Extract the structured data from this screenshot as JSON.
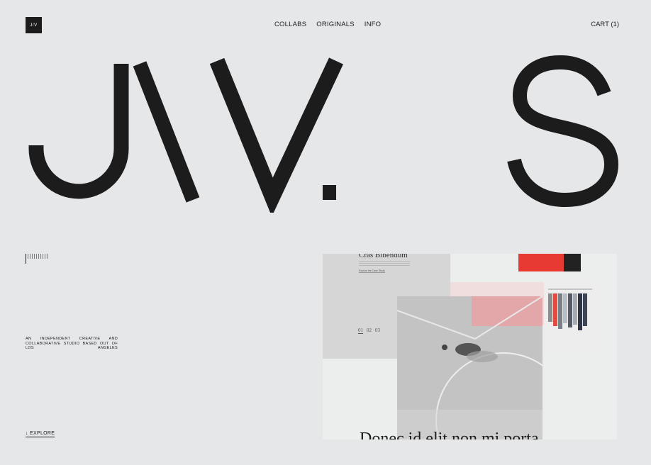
{
  "header": {
    "logo_text": "J/V",
    "nav": [
      "COLLABS",
      "ORIGINALS",
      "INFO"
    ],
    "cart_label": "CART (1)"
  },
  "hero": {
    "wordmark": "J/V. S"
  },
  "intro": {
    "tagline": "AN INDEPENDENT CREATIVE AND COLLABORATIVE STUDIO BASED OUT OF LOS ANGELES",
    "explore_label": "↓ EXPLORE"
  },
  "collage": {
    "page_title": "Cras Bibendum",
    "page_link": "Explore the Case Study",
    "pagination": [
      "01",
      "02",
      "03"
    ],
    "caption": "Donec id elit non mi porta"
  },
  "colors": {
    "background": "#e6e7e9",
    "ink": "#1c1c1c",
    "accent_red": "#e73a33",
    "accent_pink": "#f0b6b9"
  }
}
